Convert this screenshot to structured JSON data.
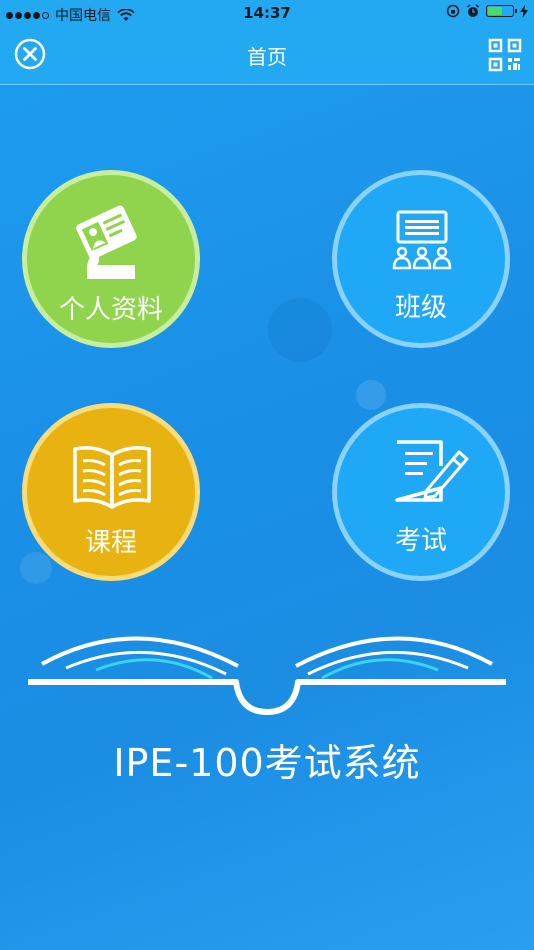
{
  "status_bar": {
    "carrier": "中国电信",
    "time": "14:37"
  },
  "nav": {
    "title": "首页"
  },
  "tiles": [
    {
      "label": "个人资料",
      "color": "#8fd44c"
    },
    {
      "label": "班级",
      "color": "#1ea8f5"
    },
    {
      "label": "课程",
      "color": "#e8b311"
    },
    {
      "label": "考试",
      "color": "#1ea8f5"
    }
  ],
  "brand": {
    "system_name": "IPE-100考试系统"
  }
}
